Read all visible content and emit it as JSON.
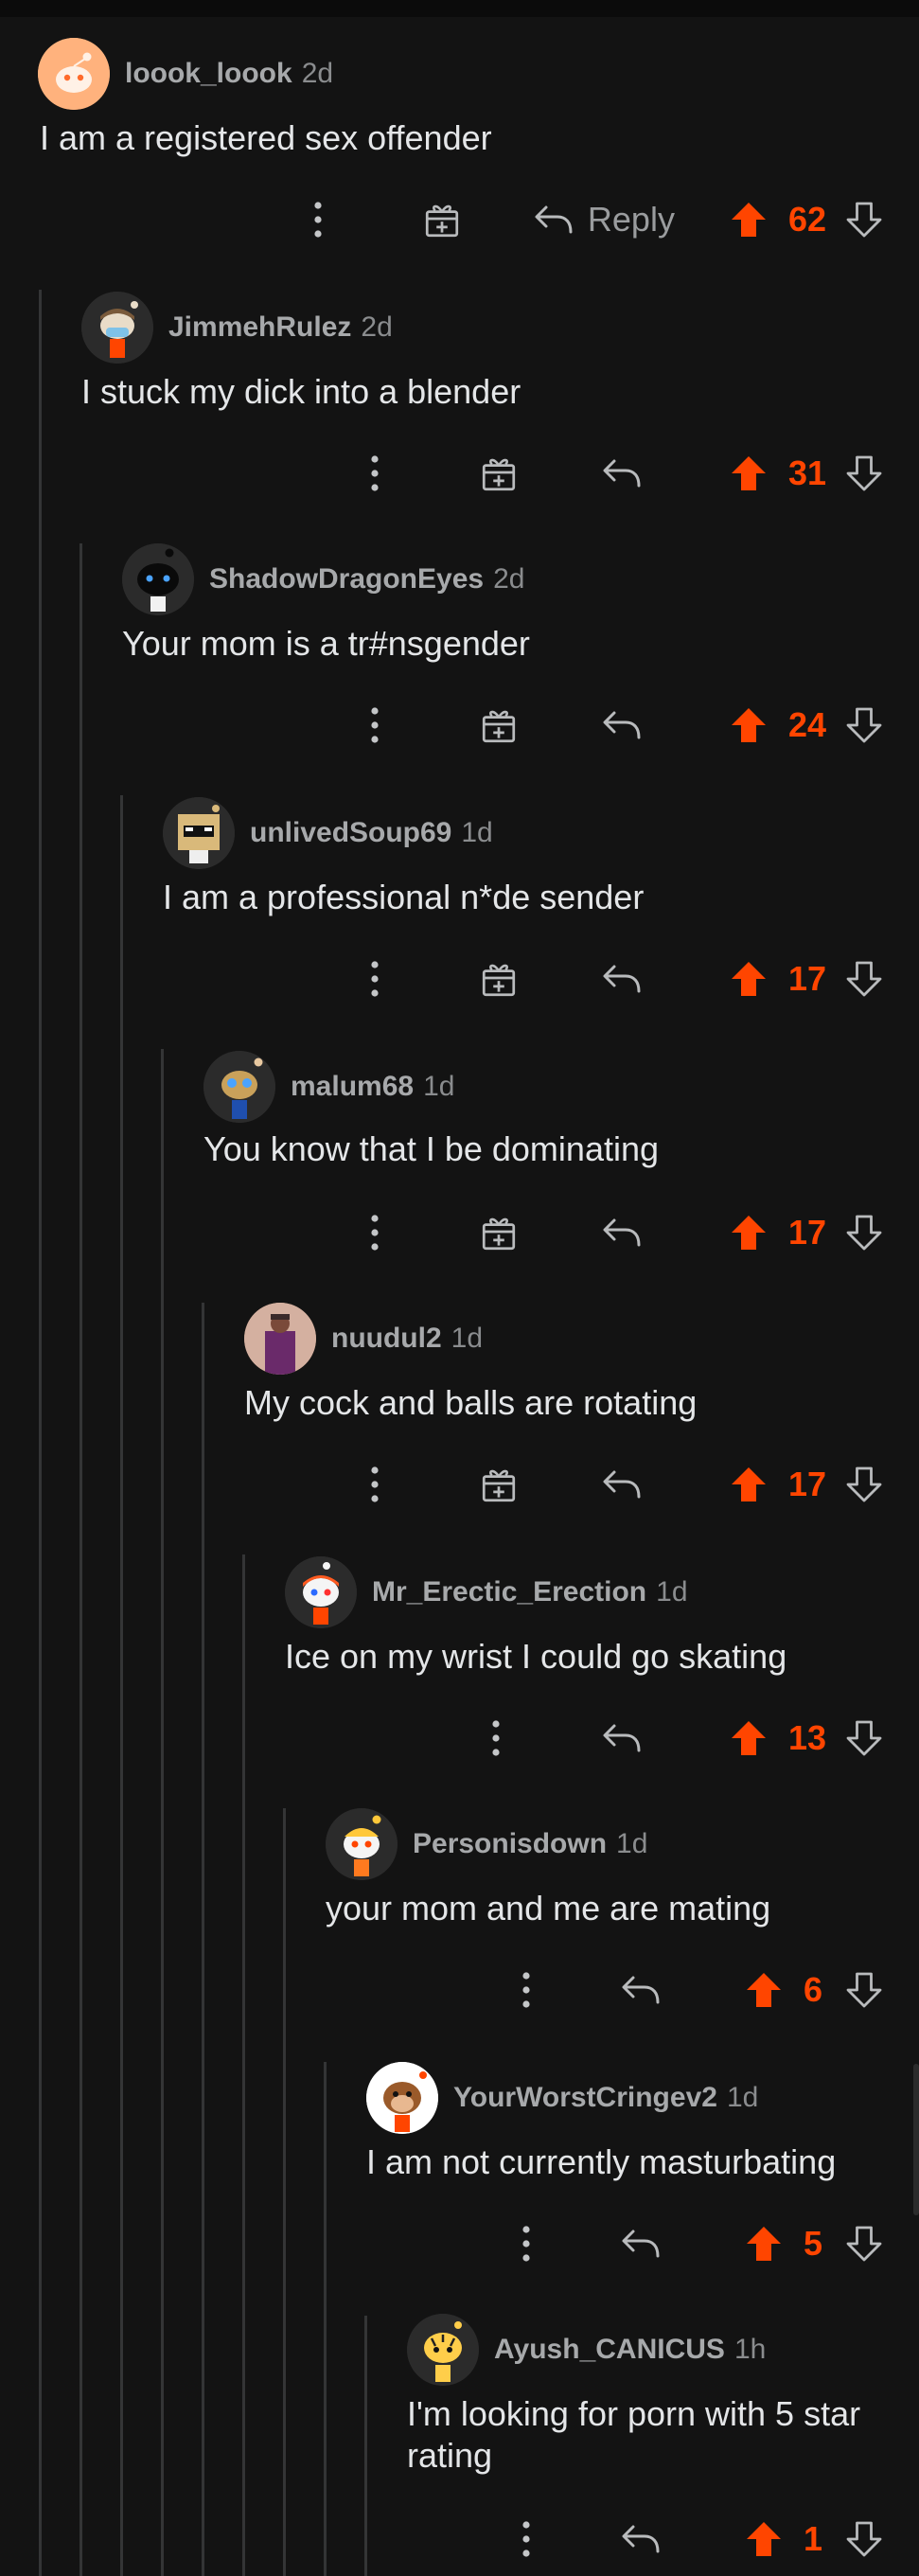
{
  "comments": [
    {
      "username": "loook_loook",
      "age": "2d",
      "body": "I am a registered sex offender",
      "score": "62",
      "reply_label": "Reply",
      "avatar_icon": "snoo-avatar-orange",
      "has_award": true
    },
    {
      "username": "JimmehRulez",
      "age": "2d",
      "body": "I stuck my dick into a blender",
      "score": "31",
      "avatar_icon": "snoo-avatar-mask",
      "has_award": true
    },
    {
      "username": "ShadowDragonEyes",
      "age": "2d",
      "body": "Your mom is a tr#nsgender",
      "score": "24",
      "avatar_icon": "snoo-avatar-dark",
      "has_award": true
    },
    {
      "username": "unlivedSoup69",
      "age": "1d",
      "body": "I am a professional n*de sender",
      "score": "17",
      "avatar_icon": "snoo-avatar-box",
      "has_award": true
    },
    {
      "username": "malum68",
      "age": "1d",
      "body": "You know that I be dominating",
      "score": "17",
      "avatar_icon": "snoo-avatar-blue",
      "has_award": true
    },
    {
      "username": "nuudul2",
      "age": "1d",
      "body": "My cock and balls are rotating",
      "score": "17",
      "avatar_icon": "photo-avatar-purple",
      "has_award": true
    },
    {
      "username": "Mr_Erectic_Erection",
      "age": "1d",
      "body": "Ice on my wrist I could go skating",
      "score": "13",
      "avatar_icon": "snoo-avatar-orange-hair",
      "has_award": false
    },
    {
      "username": "Personisdown",
      "age": "1d",
      "body": "your mom and me are mating",
      "score": "6",
      "avatar_icon": "snoo-avatar-cap",
      "has_award": false
    },
    {
      "username": "YourWorstCringev2",
      "age": "1d",
      "body": "I am not currently masturbating",
      "score": "5",
      "avatar_icon": "snoo-avatar-monkey",
      "has_award": false
    },
    {
      "username": "Ayush_CANICUS",
      "age": "1h",
      "body": "I'm looking for porn with 5 star rating",
      "score": "1",
      "avatar_icon": "snoo-avatar-tiger",
      "has_award": false
    }
  ],
  "colors": {
    "background": "#131313",
    "upvote_active": "#ff4500",
    "thread_line": "#343536",
    "username": "#a7a9ab",
    "body_text": "#e4e6e8"
  }
}
